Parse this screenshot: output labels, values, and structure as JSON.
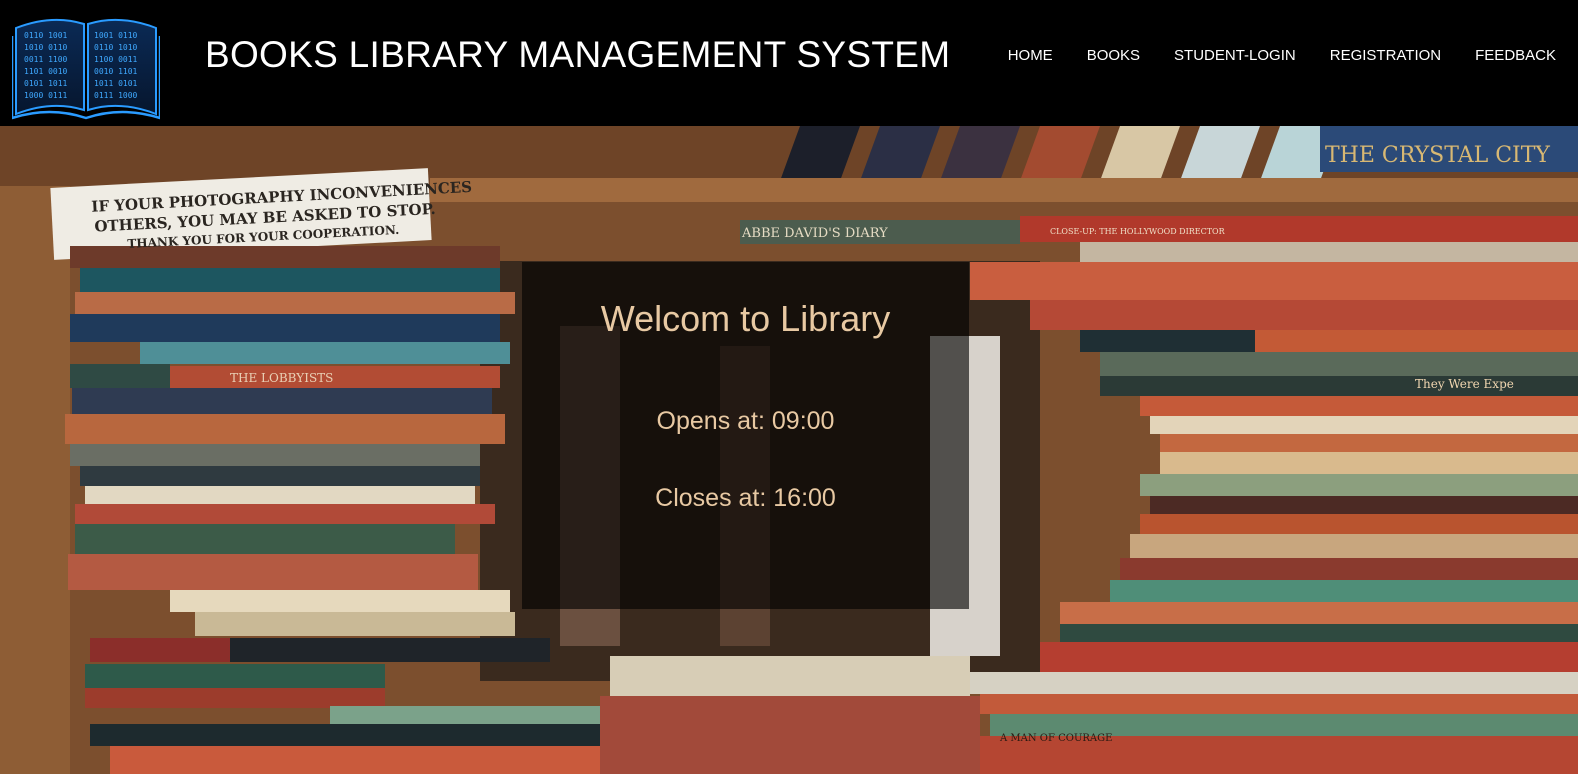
{
  "header": {
    "title": "BOOKS LIBRARY MANAGEMENT SYSTEM",
    "logo_icon": "open-book-binary-icon"
  },
  "nav": {
    "items": [
      {
        "label": "HOME"
      },
      {
        "label": "BOOKS"
      },
      {
        "label": "STUDENT-LOGIN"
      },
      {
        "label": "REGISTRATION"
      },
      {
        "label": "FEEDBACK"
      }
    ]
  },
  "hero": {
    "background": "bookshelf-photo",
    "sign_lines": [
      "IF YOUR PHOTOGRAPHY INCONVENIENCES",
      "OTHERS, YOU MAY BE ASKED TO STOP.",
      "THANK YOU FOR YOUR COOPERATION."
    ],
    "book_spines": [
      "ABBE DAVID'S DIARY",
      "CLOSE-UP: THE HOLLYWOOD DIRECTOR",
      "THE LOBBYISTS",
      "THE CRYSTAL CITY",
      "They Were Expe",
      "A MAN OF COURAGE"
    ]
  },
  "welcome": {
    "title": "Welcom to Library",
    "opens": "Opens at: 09:00",
    "closes": "Closes at: 16:00"
  },
  "colors": {
    "header_bg": "#000000",
    "header_text": "#ffffff",
    "welcome_text": "#e8c9a3",
    "logo_blue": "#1e90ff"
  }
}
